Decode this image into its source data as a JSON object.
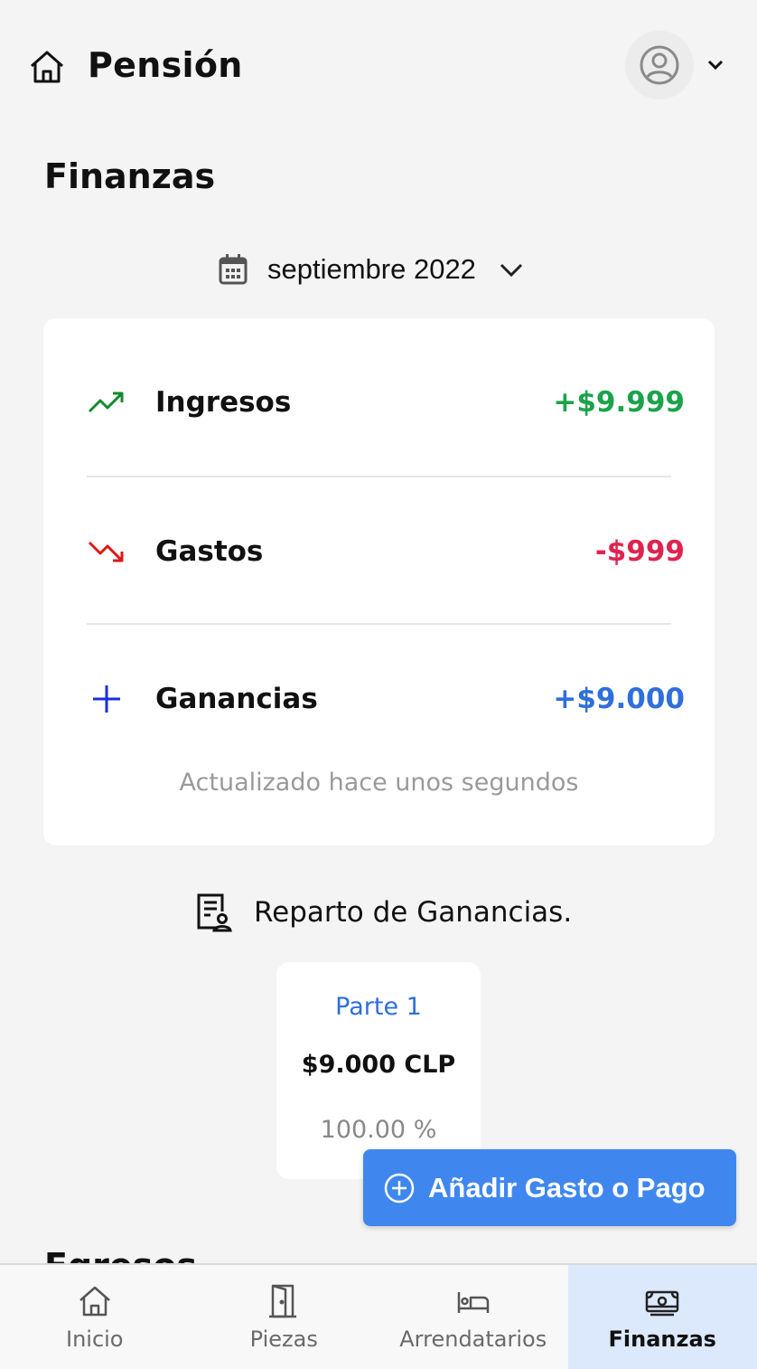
{
  "header": {
    "title": "Pensión",
    "home_icon": "home-icon",
    "avatar_icon": "user-circle-icon",
    "menu_icon": "chevron-down-icon"
  },
  "section_title": "Finanzas",
  "month_picker": {
    "label": "septiembre 2022",
    "icon": "calendar-icon"
  },
  "summary": {
    "rows": [
      {
        "label": "Ingresos",
        "value": "+$9.999",
        "icon": "trending-up-icon",
        "color": "#1aa34a"
      },
      {
        "label": "Gastos",
        "value": "-$999",
        "icon": "trending-down-icon",
        "color": "#e0234e"
      },
      {
        "label": "Ganancias",
        "value": "+$9.000",
        "icon": "plus-icon",
        "color": "#2f6fdc"
      }
    ],
    "updated": "Actualizado hace unos segundos"
  },
  "reparto": {
    "title": "Reparto de Ganancias.",
    "icon": "document-user-icon",
    "parts": [
      {
        "name": "Parte 1",
        "amount": "$9.000 CLP",
        "percent": "100.00 %"
      }
    ]
  },
  "partial_heading": "Egresos",
  "fab": {
    "label": "Añadir Gasto o Pago",
    "icon": "plus-circle-icon",
    "color": "#3f87ef"
  },
  "bottom_nav": {
    "items": [
      {
        "label": "Inicio",
        "icon": "home-icon"
      },
      {
        "label": "Piezas",
        "icon": "door-icon"
      },
      {
        "label": "Arrendatarios",
        "icon": "bed-icon"
      },
      {
        "label": "Finanzas",
        "icon": "money-icon",
        "active": true
      }
    ]
  }
}
